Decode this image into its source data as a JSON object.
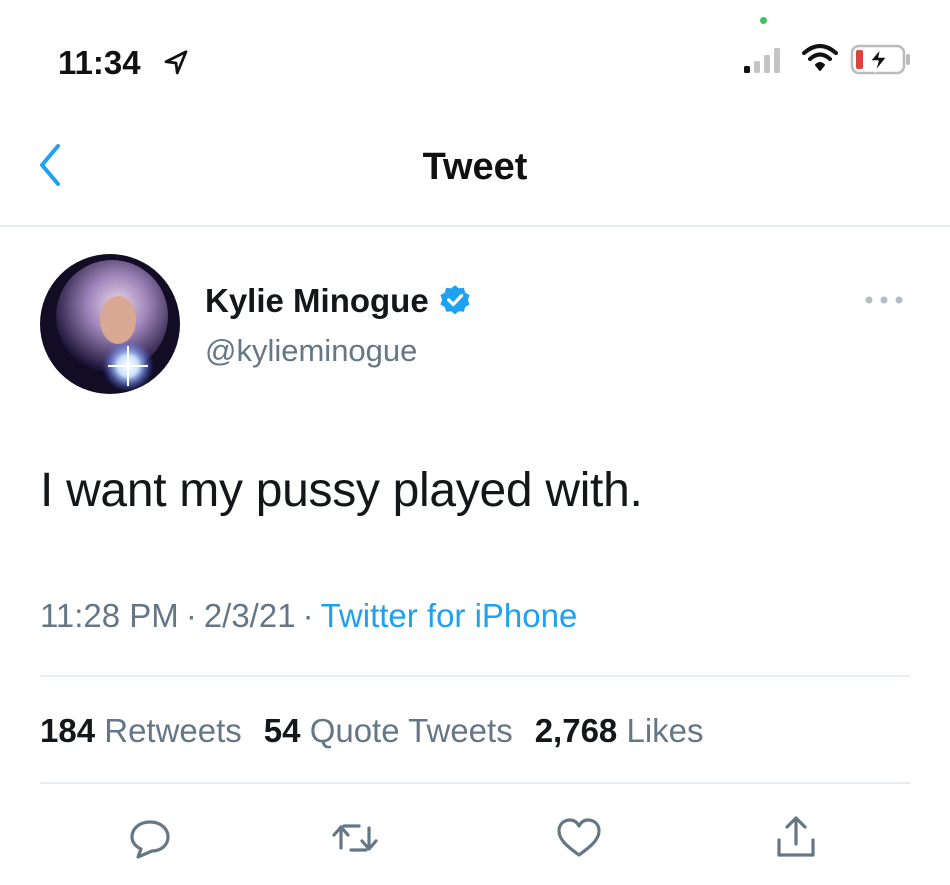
{
  "status_bar": {
    "time": "11:34",
    "icons": [
      "location-arrow-icon",
      "signal-icon",
      "wifi-icon",
      "battery-charging-icon"
    ],
    "battery_color": "#e0413a"
  },
  "nav": {
    "title": "Tweet",
    "back_icon": "chevron-left-icon"
  },
  "tweet": {
    "author_name": "Kylie Minogue",
    "verified": true,
    "handle": "@kylieminogue",
    "text": "I want my pussy played with.",
    "time": "11:28 PM",
    "date": "2/3/21",
    "separator": "·",
    "source": "Twitter for iPhone",
    "stats": {
      "retweets_count": "184",
      "retweets_label": "Retweets",
      "quotes_count": "54",
      "quotes_label": "Quote Tweets",
      "likes_count": "2,768",
      "likes_label": "Likes"
    },
    "actions": [
      "reply-icon",
      "retweet-icon",
      "like-icon",
      "share-icon"
    ]
  },
  "colors": {
    "accent": "#1da1f2",
    "secondary_text": "#657786",
    "divider": "#e6ecf0"
  }
}
